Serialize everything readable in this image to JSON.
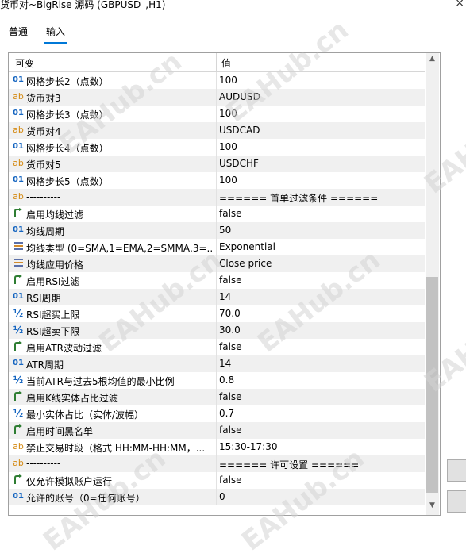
{
  "window": {
    "title": "货币对~BigRise 源码 (GBPUSD_,H1)"
  },
  "tabs": [
    {
      "label": "普通"
    },
    {
      "label": "输入"
    }
  ],
  "table": {
    "headers": {
      "variable": "可变",
      "value": "值"
    },
    "rows": [
      {
        "type": "int",
        "icon": "01",
        "name": "网格步长2（点数）",
        "value": "100"
      },
      {
        "type": "string",
        "icon": "ab",
        "name": "货币对3",
        "value": "AUDUSD"
      },
      {
        "type": "int",
        "icon": "01",
        "name": "网格步长3（点数）",
        "value": "100"
      },
      {
        "type": "string",
        "icon": "ab",
        "name": "货币对4",
        "value": "USDCAD"
      },
      {
        "type": "int",
        "icon": "01",
        "name": "网格步长4（点数）",
        "value": "100"
      },
      {
        "type": "string",
        "icon": "ab",
        "name": "货币对5",
        "value": "USDCHF"
      },
      {
        "type": "int",
        "icon": "01",
        "name": "网格步长5（点数）",
        "value": "100"
      },
      {
        "type": "string",
        "icon": "ab",
        "name": "----------",
        "value": "====== 首单过滤条件 ======"
      },
      {
        "type": "bool",
        "icon": "arrow",
        "name": "启用均线过滤",
        "value": "false"
      },
      {
        "type": "int",
        "icon": "01",
        "name": "均线周期",
        "value": "50"
      },
      {
        "type": "enum",
        "icon": "enum",
        "name": "均线类型 (0=SMA,1=EMA,2=SMMA,3=...",
        "value": "Exponential"
      },
      {
        "type": "enum",
        "icon": "enum",
        "name": "均线应用价格",
        "value": "Close price"
      },
      {
        "type": "bool",
        "icon": "arrow",
        "name": "启用RSI过滤",
        "value": "false"
      },
      {
        "type": "int",
        "icon": "01",
        "name": "RSI周期",
        "value": "14"
      },
      {
        "type": "double",
        "icon": "½",
        "name": "RSI超买上限",
        "value": "70.0"
      },
      {
        "type": "double",
        "icon": "½",
        "name": "RSI超卖下限",
        "value": "30.0"
      },
      {
        "type": "bool",
        "icon": "arrow",
        "name": "启用ATR波动过滤",
        "value": "false"
      },
      {
        "type": "int",
        "icon": "01",
        "name": "ATR周期",
        "value": "14"
      },
      {
        "type": "double",
        "icon": "½",
        "name": "当前ATR与过去5根均值的最小比例",
        "value": "0.8"
      },
      {
        "type": "bool",
        "icon": "arrow",
        "name": "启用K线实体占比过滤",
        "value": "false"
      },
      {
        "type": "double",
        "icon": "½",
        "name": "最小实体占比（实体/波幅）",
        "value": "0.7"
      },
      {
        "type": "bool",
        "icon": "arrow",
        "name": "启用时间黑名单",
        "value": "false"
      },
      {
        "type": "string",
        "icon": "ab",
        "name": "禁止交易时段（格式 HH:MM-HH:MM，...",
        "value": "15:30-17:30"
      },
      {
        "type": "string",
        "icon": "ab",
        "name": "----------",
        "value": "====== 许可设置 ======"
      },
      {
        "type": "bool",
        "icon": "arrow",
        "name": "仅允许模拟账户运行",
        "value": "false"
      },
      {
        "type": "int",
        "icon": "01",
        "name": "允许的账号（0=任何账号）",
        "value": "0"
      }
    ]
  },
  "watermark": {
    "text": "EAHub.cn"
  },
  "colors": {
    "tab_accent": "#0078d7",
    "int_icon": "#1565c0",
    "string_icon": "#d4880f",
    "bool_icon": "#2e7d32",
    "row_alt": "#f0f0f0"
  }
}
